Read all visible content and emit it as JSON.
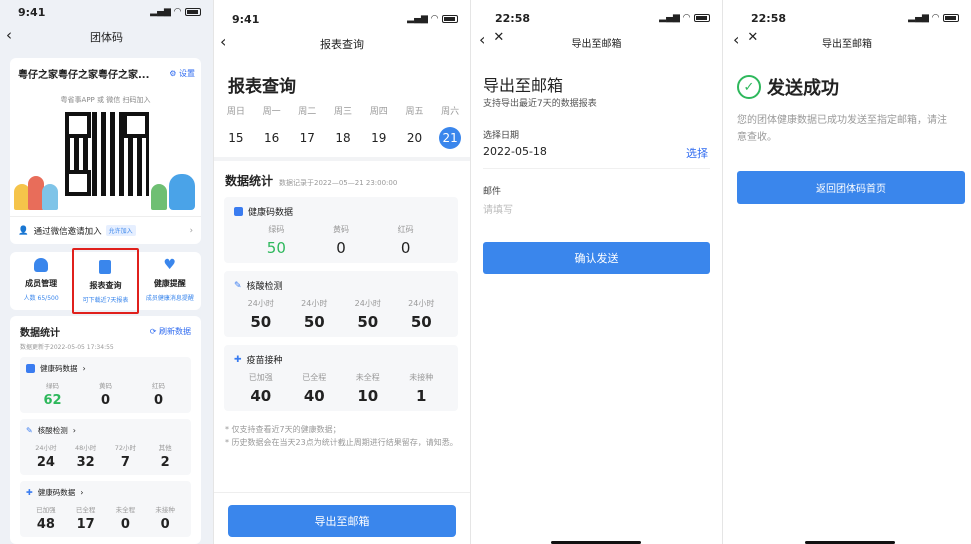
{
  "panel1": {
    "time": "9:41",
    "title": "团体码",
    "group_name": "粤仔之家粤仔之家粤仔之家...",
    "settings": "设置",
    "app_hint": "粤省事APP 或 微信 扫码加入",
    "invite": "通过微信邀请加入",
    "invite_badge": "允许加入",
    "features": [
      {
        "label": "成员管理",
        "sub": "人数 65/500"
      },
      {
        "label": "报表查询",
        "sub": "可下载近7天报表"
      },
      {
        "label": "健康提醒",
        "sub": "成员健康消息提醒"
      }
    ],
    "stats_title": "数据统计",
    "refresh": "刷新数据",
    "updated": "数据更新于2022-05-05 17:34:55",
    "health": {
      "title": "健康码数据",
      "labels": [
        "绿码",
        "黄码",
        "红码"
      ],
      "values": [
        "62",
        "0",
        "0"
      ]
    },
    "nucleic": {
      "title": "核酸检测",
      "labels": [
        "24小时",
        "48小时",
        "72小时",
        "其他"
      ],
      "values": [
        "24",
        "32",
        "7",
        "2"
      ]
    },
    "vaccine": {
      "title": "健康码数据",
      "labels": [
        "已加强",
        "已全程",
        "未全程",
        "未接种"
      ],
      "values": [
        "48",
        "17",
        "0",
        "0"
      ]
    }
  },
  "panel2": {
    "time": "9:41",
    "nav_title": "报表查询",
    "page_title": "报表查询",
    "weekdays": [
      "周日",
      "周一",
      "周二",
      "周三",
      "周四",
      "周五",
      "周六"
    ],
    "days": [
      "15",
      "16",
      "17",
      "18",
      "19",
      "20",
      "21"
    ],
    "stats_title": "数据统计",
    "stats_note": "数据记录于2022—05—21 23:00:00",
    "health": {
      "title": "健康码数据",
      "labels": [
        "绿码",
        "黄码",
        "红码"
      ],
      "values": [
        "50",
        "0",
        "0"
      ]
    },
    "nucleic": {
      "title": "核酸检测",
      "labels": [
        "24小时",
        "24小时",
        "24小时",
        "24小时"
      ],
      "values": [
        "50",
        "50",
        "50",
        "50"
      ]
    },
    "vaccine": {
      "title": "疫苗接种",
      "labels": [
        "已加强",
        "已全程",
        "未全程",
        "未接种"
      ],
      "values": [
        "40",
        "40",
        "10",
        "1"
      ]
    },
    "notes": [
      "* 仅支持查看近7天的健康数据；",
      "* 历史数据会在当天23点为统计截止周期进行结果留存，请知悉。"
    ],
    "export_btn": "导出至邮箱"
  },
  "panel3": {
    "time": "22:58",
    "nav_title": "导出至邮箱",
    "heading": "导出至邮箱",
    "sub": "支持导出最近7天的数据报表",
    "date_label": "选择日期",
    "date_value": "2022-05-18",
    "select": "选择",
    "mail_label": "邮件",
    "mail_placeholder": "请填写",
    "confirm": "确认发送"
  },
  "panel4": {
    "time": "22:58",
    "nav_title": "导出至邮箱",
    "success": "发送成功",
    "message": "您的团体健康数据已成功发送至指定邮箱，请注意查收。",
    "back": "返回团体码首页"
  },
  "colors": {
    "accent": "#3a86ec",
    "green": "#2eb85c",
    "highlight": "#e0201c"
  }
}
